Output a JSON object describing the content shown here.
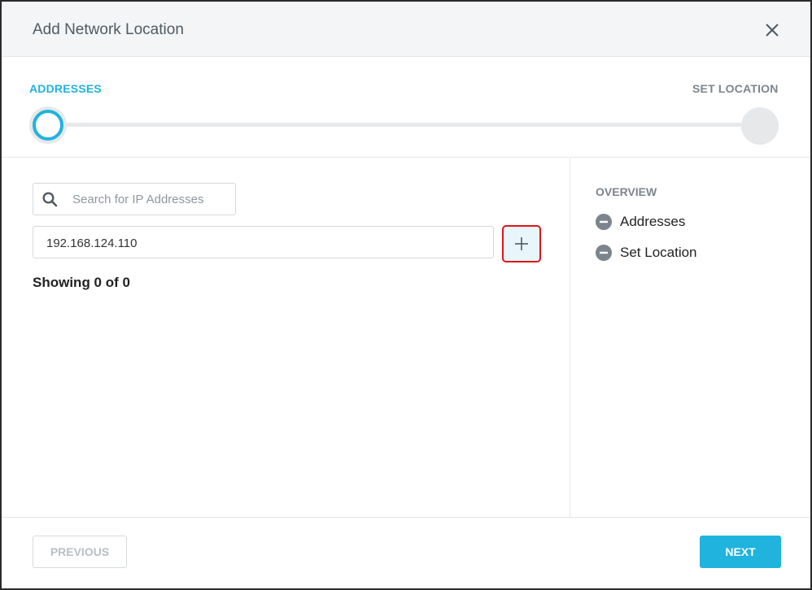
{
  "dialog": {
    "title": "Add Network Location",
    "close_icon": "close-icon"
  },
  "stepper": {
    "steps": [
      {
        "label": "ADDRESSES",
        "state": "active"
      },
      {
        "label": "SET LOCATION",
        "state": "inactive"
      }
    ],
    "progress_fraction": 0
  },
  "addresses": {
    "search": {
      "placeholder": "Search for IP Addresses",
      "value": "",
      "icon": "search-icon"
    },
    "ip_input": {
      "value": "192.168.124.110"
    },
    "add_button": {
      "icon": "plus-icon"
    },
    "showing_text": "Showing 0 of 0"
  },
  "overview": {
    "title": "OVERVIEW",
    "items": [
      {
        "label": "Addresses",
        "icon": "minus-circle-icon"
      },
      {
        "label": "Set Location",
        "icon": "minus-circle-icon"
      }
    ]
  },
  "footer": {
    "previous_label": "PREVIOUS",
    "next_label": "NEXT"
  },
  "colors": {
    "accent": "#1fb3de",
    "highlight_border": "#e0141b",
    "muted_text": "#7c858d"
  }
}
